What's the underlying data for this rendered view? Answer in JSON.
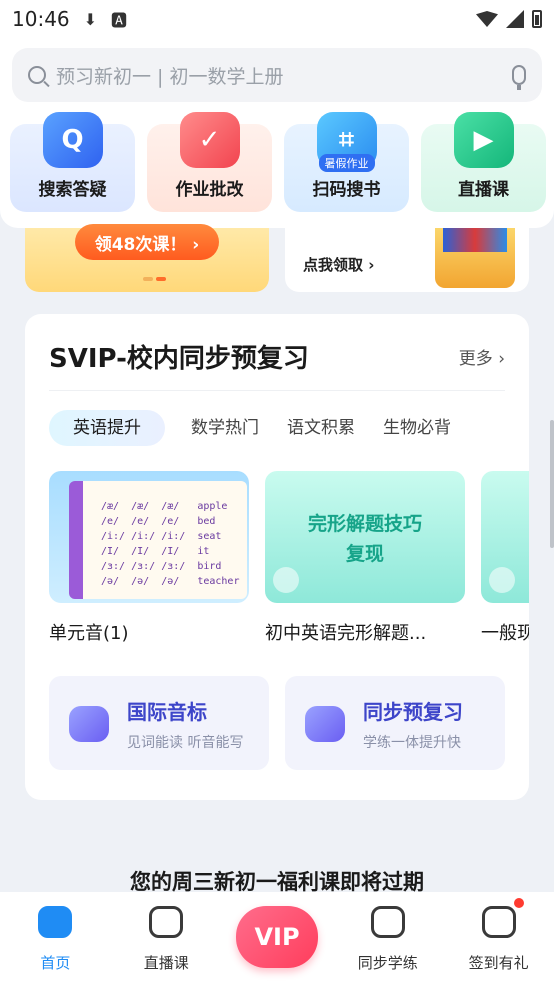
{
  "status_bar": {
    "time": "10:46"
  },
  "search": {
    "placeholder": "预习新初一 | 初一数学上册"
  },
  "tools": [
    {
      "label": "搜索答疑"
    },
    {
      "label": "作业批改"
    },
    {
      "label": "扫码搜书",
      "tag": "暑假作业"
    },
    {
      "label": "直播课"
    }
  ],
  "banners": {
    "left_pill": "领48次课！ ›",
    "right_text": "点我领取 ›"
  },
  "svip": {
    "title": "SVIP-校内同步预复习",
    "more": "更多 ›",
    "tabs": [
      "英语提升",
      "数学热门",
      "语文积累",
      "生物必背"
    ],
    "active_tab": "英语提升",
    "courses": [
      {
        "name": "单元音(1)",
        "thumb_text": "/æ/  /æ/  /æ/   apple\n/e/  /e/  /e/   bed\n/i:/ /i:/ /i:/  seat\n/I/  /I/  /I/   it\n/ɜ:/ /ɜ:/ /ɜ:/  bird\n/ə/  /ə/  /ə/   teacher"
      },
      {
        "name": "初中英语完形解题...",
        "thumb_line1": "完形解题技巧",
        "thumb_line2": "复现"
      },
      {
        "name": "一般现"
      }
    ],
    "features": [
      {
        "title": "国际音标",
        "subtitle": "见词能读 听音能写"
      },
      {
        "title": "同步预复习",
        "subtitle": "学练一体提升快"
      }
    ]
  },
  "notice": "您的周三新初一福利课即将过期",
  "nav": {
    "items": [
      "首页",
      "直播课",
      "同步学练",
      "签到有礼"
    ],
    "vip_label": "VIP"
  },
  "colors": {
    "accent": "#1f8cf4",
    "feature_title": "#3d45c9"
  }
}
